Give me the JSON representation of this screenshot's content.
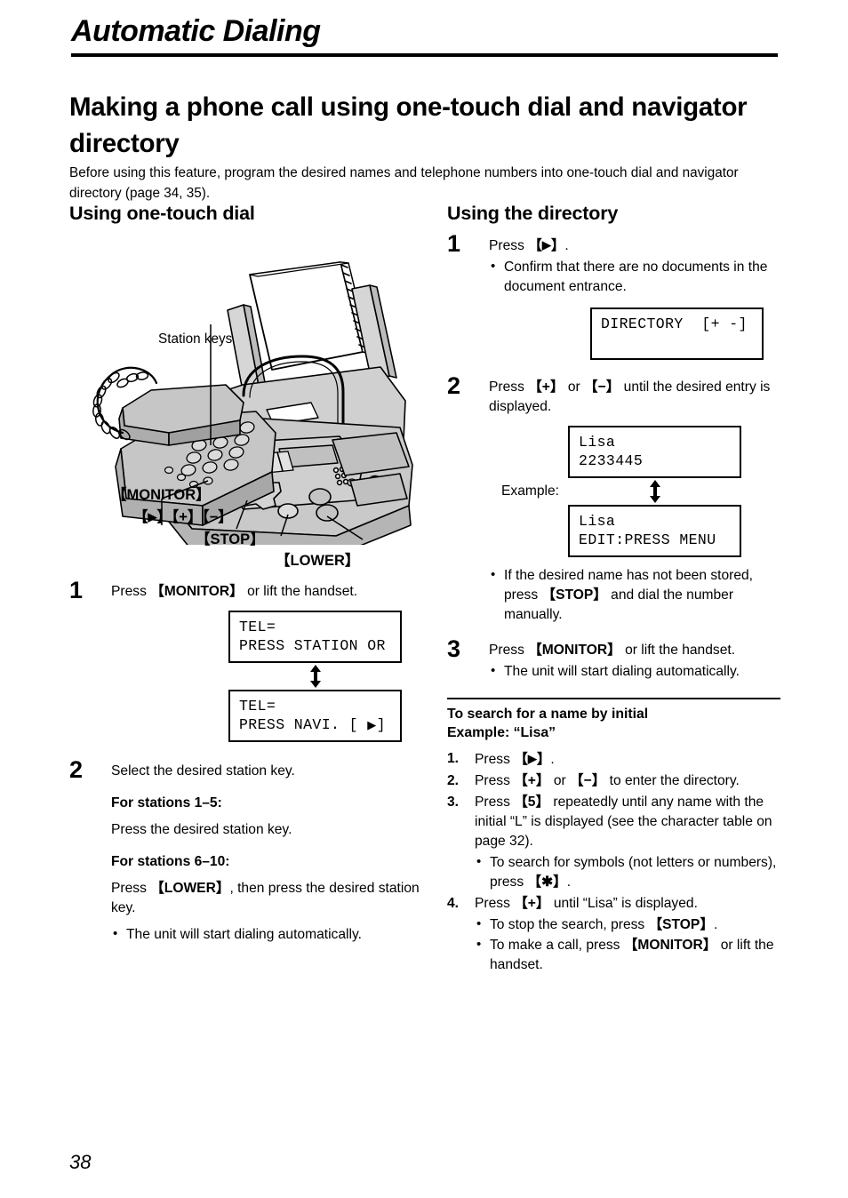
{
  "header": {
    "chapter_title": "Automatic Dialing"
  },
  "section": {
    "heading": "Making a phone call using one-touch dial and navigator directory",
    "intro": "Before using this feature, program the desired names and telephone numbers into one-touch dial and navigator directory (page 34, 35)."
  },
  "left_column": {
    "heading": "Using one-touch dial",
    "figure": {
      "callout_station_keys": "Station keys",
      "callout_monitor": "【MONITOR】",
      "callout_arrow_plus_minus": "【  】【+】【−】",
      "callout_stop": "【STOP】",
      "callout_lower": "【LOWER】"
    },
    "step1": {
      "number": "1",
      "text_before": "Press ",
      "key": "【MONITOR】",
      "text_after": " or lift the handset.",
      "lcd_top_line1": "TEL=",
      "lcd_top_line2": "PRESS STATION OR",
      "lcd_bottom_line1": "TEL=",
      "lcd_bottom_line2": "PRESS NAVI. [  ]"
    },
    "step2": {
      "number": "2",
      "text": "Select the desired station key.",
      "sub1_heading": "For stations 1–5:",
      "sub1_text": "Press the desired station key.",
      "sub2_heading": "For stations 6–10:",
      "sub2_text_before": "Press ",
      "sub2_key": "【LOWER】",
      "sub2_text_after": ", then press the desired station key.",
      "bullet": "The unit will start dialing automatically."
    }
  },
  "right_column": {
    "heading": "Using the directory",
    "step1": {
      "number": "1",
      "text_before": "Press ",
      "key": "【  】",
      "text_after": ".",
      "bullet": "Confirm that there are no documents in the document entrance.",
      "lcd_line1": "DIRECTORY  [+ -]",
      "lcd_line2": ""
    },
    "step2": {
      "number": "2",
      "text_before": "Press ",
      "key_plus": "【+】",
      "text_mid": " or ",
      "key_minus": "【−】",
      "text_after": " until the desired entry is displayed.",
      "example_label": "Example:",
      "lcd_top_line1": "Lisa",
      "lcd_top_line2": "2233445",
      "lcd_bottom_line1": "Lisa",
      "lcd_bottom_line2": "EDIT:PRESS MENU",
      "bullet_before": "If the desired name has not been stored, press ",
      "bullet_key": "【STOP】",
      "bullet_after": " and dial the number manually."
    },
    "step3": {
      "number": "3",
      "text_before": "Press ",
      "key": "【MONITOR】",
      "text_after": " or lift the handset.",
      "bullet": "The unit will start dialing automatically."
    },
    "search_section": {
      "heading_line1": "To search for a name by initial",
      "heading_line2": "Example: “Lisa”",
      "items": [
        {
          "num": "1.",
          "text_before": "Press ",
          "key": "【  】",
          "text_after": "."
        },
        {
          "num": "2.",
          "text_before": "Press ",
          "key": "【+】",
          "text_mid": " or ",
          "key2": "【−】",
          "text_after": " to enter the directory."
        },
        {
          "num": "3.",
          "text_before": "Press ",
          "key": "【5】",
          "text_after": " repeatedly until any name with the initial “L” is displayed (see the character table on page 32).",
          "bullet_before": "To search for symbols (not letters or numbers), press ",
          "bullet_key": "【✱】",
          "bullet_after": "."
        },
        {
          "num": "4.",
          "text_before": "Press ",
          "key": "【+】",
          "text_after": " until “Lisa” is displayed.",
          "bullets": [
            {
              "before": "To stop the search, press ",
              "key": "【STOP】",
              "after": "."
            },
            {
              "before": "To make a call, press ",
              "key": "【MONITOR】",
              "after": " or lift the handset."
            }
          ]
        }
      ]
    }
  },
  "footer": {
    "page_number": "38"
  }
}
